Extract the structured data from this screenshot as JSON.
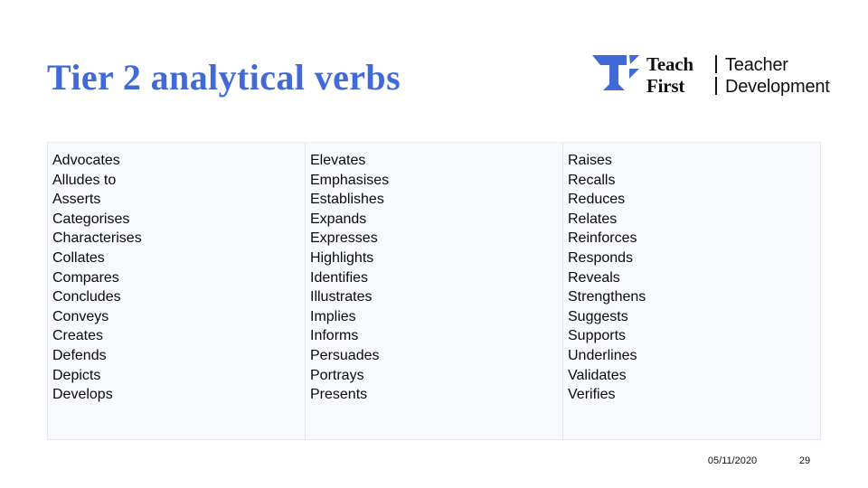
{
  "slide": {
    "title": "Tier 2 analytical verbs",
    "title_color": "#4169d8",
    "background": "#ffffff"
  },
  "logo": {
    "mark_name": "teach-first-tf-monogram",
    "mark_color": "#4169d8",
    "brand_line1": "Teach",
    "brand_line2": "First",
    "sub_line1": "Teacher",
    "sub_line2": "Development"
  },
  "table": {
    "background": "#f8f9fd",
    "border_color": "#e7e9f2",
    "columns": [
      {
        "name": "column-1",
        "items": [
          "Advocates",
          "Alludes to",
          "Asserts",
          "Categorises",
          "Characterises",
          "Collates",
          "Compares",
          "Concludes",
          "Conveys",
          "Creates",
          "Defends",
          "Depicts",
          "Develops"
        ]
      },
      {
        "name": "column-2",
        "items": [
          "Elevates",
          "Emphasises",
          "Establishes",
          "Expands",
          "Expresses",
          "Highlights",
          "Identifies",
          "Illustrates",
          "Implies",
          "Informs",
          "Persuades",
          "Portrays",
          "Presents"
        ]
      },
      {
        "name": "column-3",
        "items": [
          "Raises",
          "Recalls",
          "Reduces",
          "Relates",
          "Reinforces",
          "Responds",
          "Reveals",
          "Strengthens",
          "Suggests",
          "Supports",
          "Underlines",
          "Validates",
          "Verifies"
        ]
      }
    ]
  },
  "footer": {
    "date": "05/11/2020",
    "page_number": "29"
  }
}
